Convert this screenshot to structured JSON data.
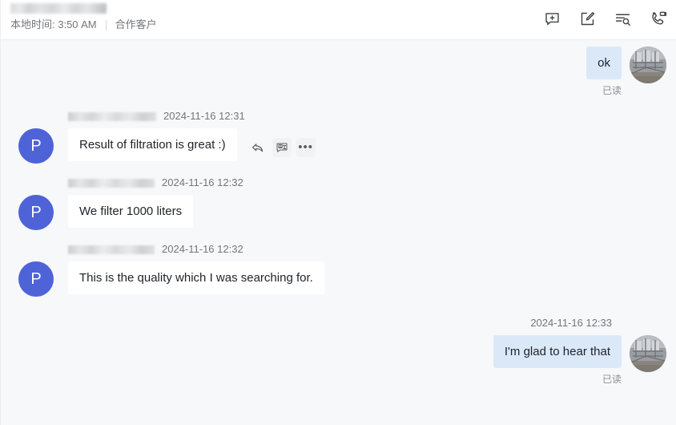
{
  "header": {
    "contact_name": "",
    "local_time_label": "本地时间: 3:50 AM",
    "tag_label": "合作客户",
    "actions": [
      {
        "name": "new-chat-icon",
        "label": "新建会话"
      },
      {
        "name": "compose-icon",
        "label": "写消息"
      },
      {
        "name": "search-history-icon",
        "label": "查找聊天记录"
      },
      {
        "name": "video-call-icon",
        "label": "视频通话"
      }
    ]
  },
  "conversation": {
    "read_receipt_label": "已读",
    "avatar_letter": "P",
    "messages": [
      {
        "direction": "out",
        "text": "ok",
        "status": "已读",
        "timestamp": ""
      },
      {
        "direction": "in",
        "sender": "",
        "timestamp": "2024-11-16 12:31",
        "text": "Result of filtration is great :)",
        "hovered": true
      },
      {
        "direction": "in",
        "sender": "",
        "timestamp": "2024-11-16 12:32",
        "text": "We filter 1000 liters",
        "hovered": false
      },
      {
        "direction": "in",
        "sender": "",
        "timestamp": "2024-11-16 12:32",
        "text": "This is the quality which I was searching for.",
        "hovered": false
      },
      {
        "direction": "out",
        "text": "I'm glad to hear that",
        "status": "已读",
        "timestamp": "2024-11-16 12:33"
      }
    ],
    "hover_actions": [
      {
        "name": "reply-icon",
        "label": "回复"
      },
      {
        "name": "translate-icon",
        "label": "翻译"
      },
      {
        "name": "more-icon",
        "label": "更多"
      }
    ]
  },
  "colors": {
    "accent_avatar": "#4e63d8",
    "outgoing_bubble": "#dbe8f8",
    "incoming_bubble": "#ffffff",
    "page_background": "#f7f8fa",
    "muted_text": "#73767c"
  }
}
